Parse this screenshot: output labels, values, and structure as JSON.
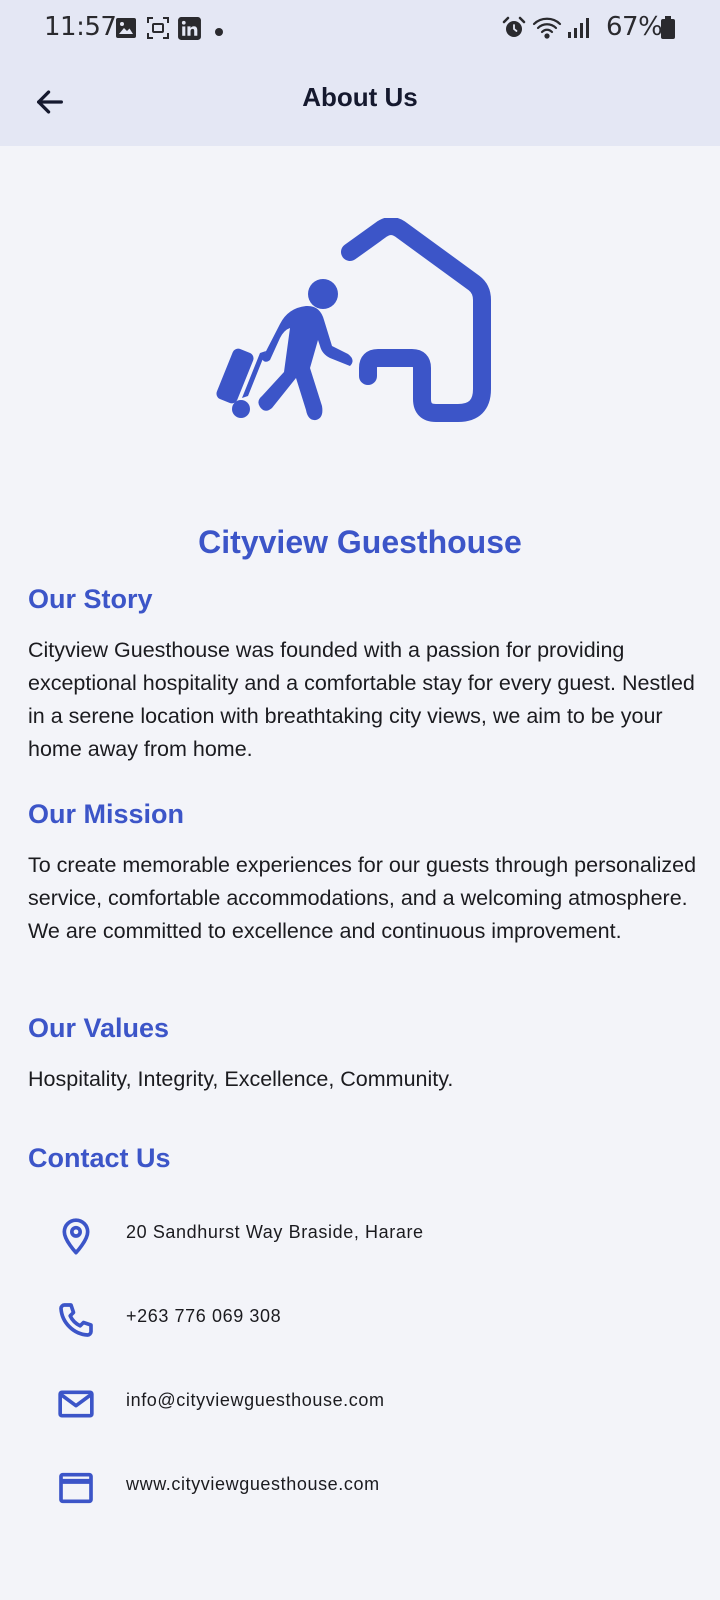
{
  "status_bar": {
    "time": "11:57",
    "battery": "67%",
    "left_icons": [
      "image-icon",
      "screenshot-icon",
      "linkedin-icon",
      "dot-icon"
    ],
    "right_icons": [
      "alarm-icon",
      "wifi-icon",
      "signal-icon",
      "battery-icon"
    ]
  },
  "app_bar": {
    "title": "About Us",
    "back_icon": "arrow-left-icon"
  },
  "logo": {
    "icon": "traveler-with-luggage-house-icon",
    "color": "#3c55c8"
  },
  "brand": {
    "name": "Cityview Guesthouse"
  },
  "sections": {
    "story": {
      "heading": "Our Story",
      "body": "Cityview Guesthouse was founded with a passion for providing exceptional hospitality and a comfortable stay for every guest. Nestled in a serene location with breathtaking city views, we aim to be your home away from home."
    },
    "mission": {
      "heading": "Our Mission",
      "body": "To create memorable experiences for our guests through personalized service, comfortable accommodations, and a welcoming atmosphere. We are committed to excellence and continuous improvement."
    },
    "values": {
      "heading": "Our Values",
      "body": "Hospitality, Integrity, Excellence, Community."
    }
  },
  "contact": {
    "heading": "Contact Us",
    "items": [
      {
        "icon": "location-pin-icon",
        "text": "20 Sandhurst Way Braside, Harare"
      },
      {
        "icon": "phone-icon",
        "text": "+263 776 069 308"
      },
      {
        "icon": "email-icon",
        "text": "info@cityviewguesthouse.com"
      },
      {
        "icon": "web-icon",
        "text": "www.cityviewguesthouse.com"
      }
    ]
  },
  "colors": {
    "accent": "#3c55c8",
    "app_bar_bg": "#e4e7f4",
    "page_bg": "#f3f4f9",
    "title_text": "#15192e"
  }
}
